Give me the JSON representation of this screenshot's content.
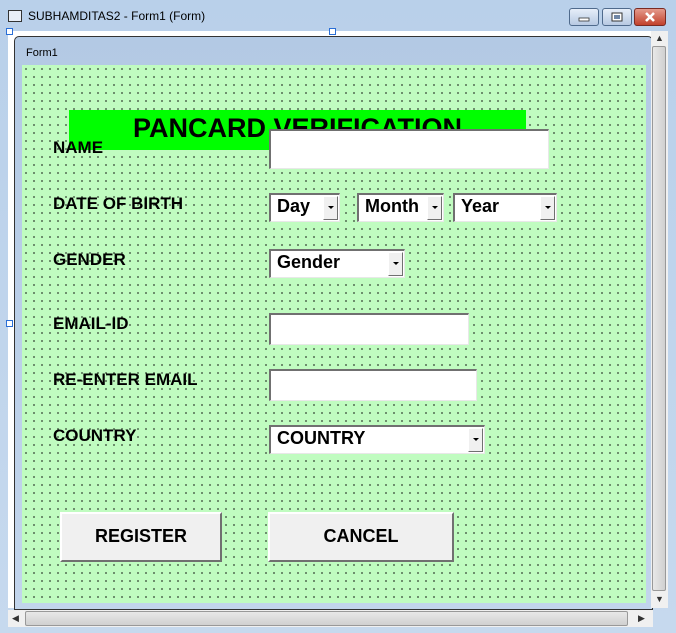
{
  "window": {
    "title": "SUBHAMDITAS2 - Form1 (Form)",
    "controls": {
      "minimize": "minimize-icon",
      "maximize": "maximize-icon",
      "close": "close-icon"
    }
  },
  "form": {
    "caption": "Form1",
    "header": "PANCARD VERIFICATION",
    "colors": {
      "background": "#c0fcc0",
      "header": "#00ff00"
    },
    "labels": {
      "name": "NAME",
      "dob": "DATE OF BIRTH",
      "gender": "GENDER",
      "email": "EMAIL-ID",
      "reemail": "RE-ENTER EMAIL",
      "country": "COUNTRY"
    },
    "fields": {
      "name": "",
      "email": "",
      "reemail": ""
    },
    "combos": {
      "day": "Day",
      "month": "Month",
      "year": "Year",
      "gender": "Gender",
      "country": "COUNTRY"
    },
    "buttons": {
      "register": "REGISTER",
      "cancel": "CANCEL"
    }
  },
  "scrollbars": {
    "vertical": "vertical-scrollbar",
    "horizontal": "horizontal-scrollbar"
  }
}
